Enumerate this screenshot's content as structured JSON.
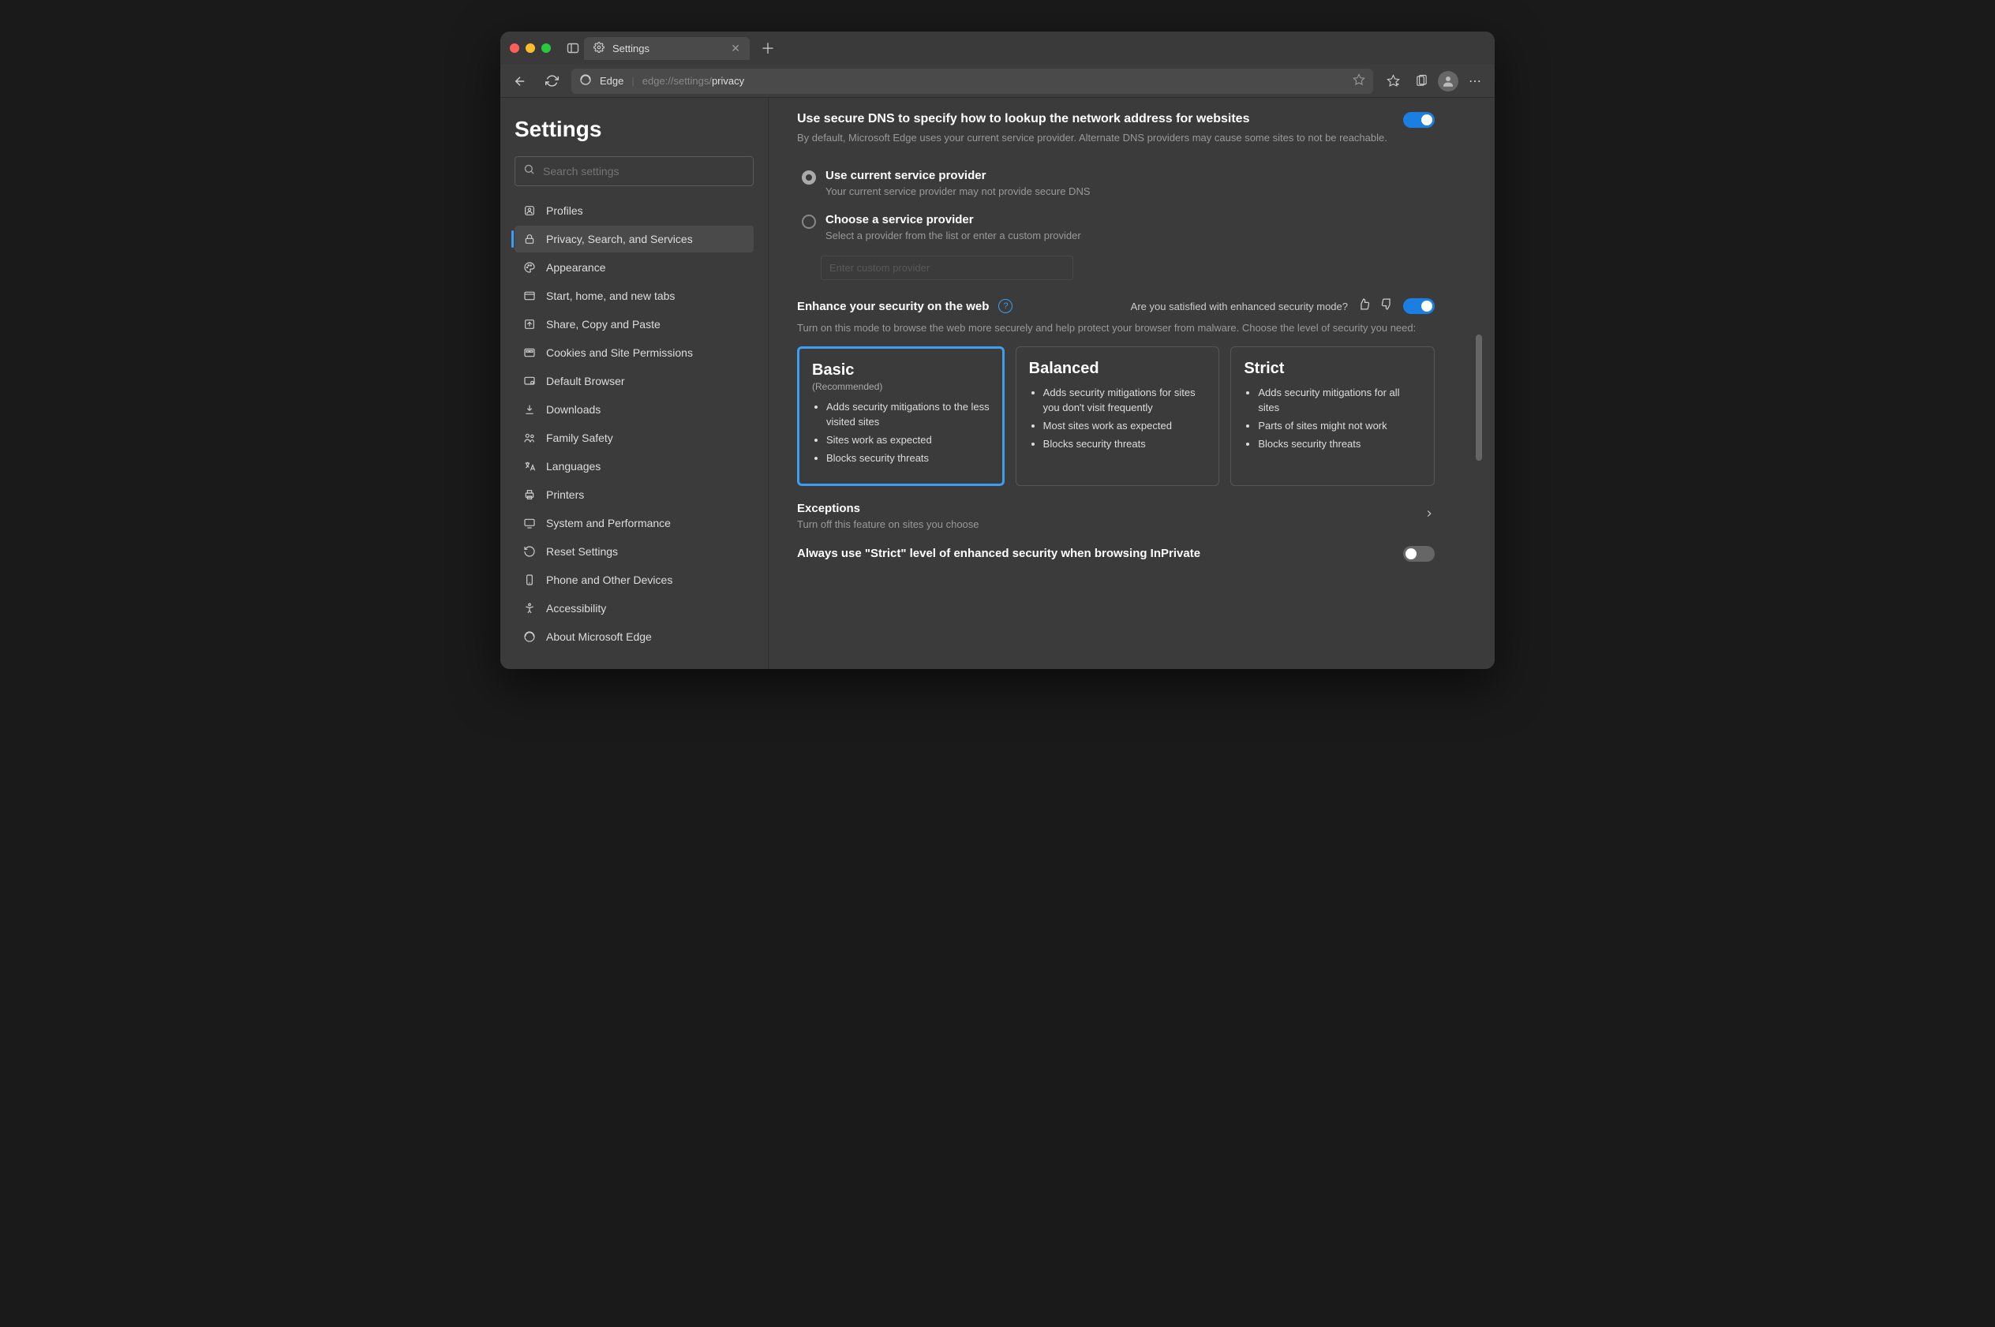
{
  "tab": {
    "title": "Settings"
  },
  "address": {
    "brand": "Edge",
    "url_dim": "edge://settings/",
    "url_bright": "privacy"
  },
  "sidebar": {
    "heading": "Settings",
    "search_placeholder": "Search settings",
    "items": [
      {
        "label": "Profiles"
      },
      {
        "label": "Privacy, Search, and Services"
      },
      {
        "label": "Appearance"
      },
      {
        "label": "Start, home, and new tabs"
      },
      {
        "label": "Share, Copy and Paste"
      },
      {
        "label": "Cookies and Site Permissions"
      },
      {
        "label": "Default Browser"
      },
      {
        "label": "Downloads"
      },
      {
        "label": "Family Safety"
      },
      {
        "label": "Languages"
      },
      {
        "label": "Printers"
      },
      {
        "label": "System and Performance"
      },
      {
        "label": "Reset Settings"
      },
      {
        "label": "Phone and Other Devices"
      },
      {
        "label": "Accessibility"
      },
      {
        "label": "About Microsoft Edge"
      }
    ]
  },
  "dns": {
    "title": "Use secure DNS to specify how to lookup the network address for websites",
    "desc": "By default, Microsoft Edge uses your current service provider. Alternate DNS providers may cause some sites to not be reachable.",
    "option1_title": "Use current service provider",
    "option1_sub": "Your current service provider may not provide secure DNS",
    "option2_title": "Choose a service provider",
    "option2_sub": "Select a provider from the list or enter a custom provider",
    "provider_placeholder": "Enter custom provider"
  },
  "enhance": {
    "title": "Enhance your security on the web",
    "feedback_q": "Are you satisfied with enhanced security mode?",
    "desc": "Turn on this mode to browse the web more securely and help protect your browser from malware. Choose the level of security you need:",
    "cards": [
      {
        "name": "Basic",
        "rec": "(Recommended)",
        "bullets": [
          "Adds security mitigations to the less visited sites",
          "Sites work as expected",
          "Blocks security threats"
        ]
      },
      {
        "name": "Balanced",
        "bullets": [
          "Adds security mitigations for sites you don't visit frequently",
          "Most sites work as expected",
          "Blocks security threats"
        ]
      },
      {
        "name": "Strict",
        "bullets": [
          "Adds security mitigations for all sites",
          "Parts of sites might not work",
          "Blocks security threats"
        ]
      }
    ]
  },
  "exceptions": {
    "title": "Exceptions",
    "sub": "Turn off this feature on sites you choose"
  },
  "inprivate": {
    "title": "Always use \"Strict\" level of enhanced security when browsing InPrivate"
  }
}
